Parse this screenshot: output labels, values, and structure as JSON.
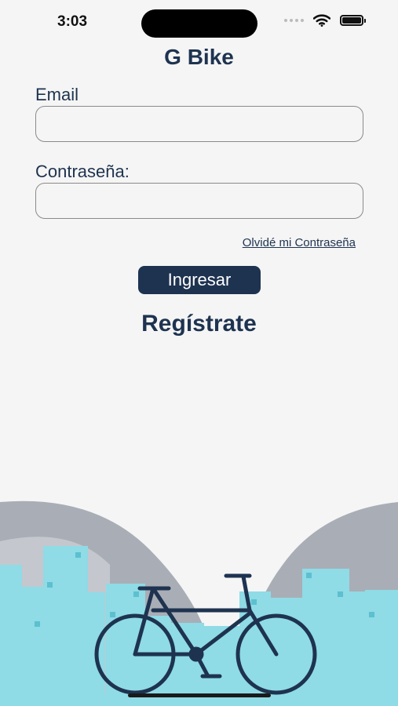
{
  "status_bar": {
    "time": "3:03"
  },
  "app": {
    "title": "G Bike"
  },
  "form": {
    "email_label": "Email",
    "email_value": "",
    "password_label": "Contraseña:",
    "password_value": "",
    "forgot_password": "Olvidé mi Contraseña",
    "login_button": "Ingresar",
    "register_link": "Regístrate"
  },
  "colors": {
    "primary": "#1e3350",
    "background": "#f5f5f5",
    "building": "#8fdbe6",
    "hill": "#a9aeb6"
  }
}
